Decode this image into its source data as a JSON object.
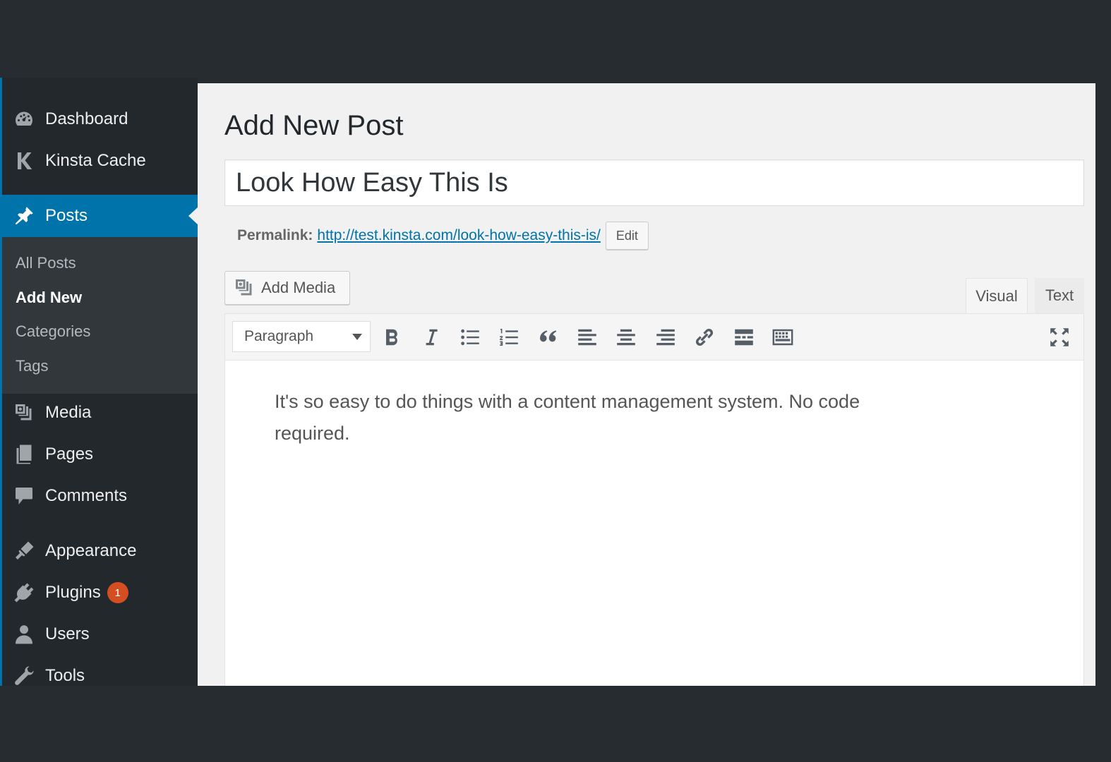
{
  "sidebar": {
    "items": [
      {
        "label": "Dashboard",
        "icon": "dashboard-icon"
      },
      {
        "label": "Kinsta Cache",
        "icon": "kinsta-icon"
      },
      {
        "label": "Posts",
        "icon": "pushpin-icon",
        "active": true
      },
      {
        "label": "Media",
        "icon": "media-icon"
      },
      {
        "label": "Pages",
        "icon": "pages-icon"
      },
      {
        "label": "Comments",
        "icon": "comments-icon"
      },
      {
        "label": "Appearance",
        "icon": "appearance-icon"
      },
      {
        "label": "Plugins",
        "icon": "plugins-icon",
        "badge": "1"
      },
      {
        "label": "Users",
        "icon": "users-icon"
      },
      {
        "label": "Tools",
        "icon": "tools-icon"
      }
    ],
    "submenu": [
      {
        "label": "All Posts"
      },
      {
        "label": "Add New",
        "current": true
      },
      {
        "label": "Categories"
      },
      {
        "label": "Tags"
      }
    ]
  },
  "main": {
    "page_title": "Add New Post",
    "post_title": "Look How Easy This Is",
    "permalink": {
      "label": "Permalink:",
      "base": "http://test.kinsta.com/",
      "slug": "look-how-easy-this-is/",
      "edit_label": "Edit"
    },
    "add_media_label": "Add Media",
    "tabs": {
      "visual": "Visual",
      "text": "Text"
    },
    "format_select": "Paragraph",
    "toolbar_buttons": [
      "bold-icon",
      "italic-icon",
      "bulleted-list-icon",
      "numbered-list-icon",
      "blockquote-icon",
      "align-left-icon",
      "align-center-icon",
      "align-right-icon",
      "link-icon",
      "read-more-icon",
      "toolbar-toggle-icon",
      "fullscreen-icon"
    ],
    "content": "It's so easy to do things with a content management system. No code required."
  },
  "colors": {
    "sidebar_bg": "#23282d",
    "accent": "#0073aa",
    "badge": "#d54e21",
    "main_bg": "#f1f1f1"
  }
}
